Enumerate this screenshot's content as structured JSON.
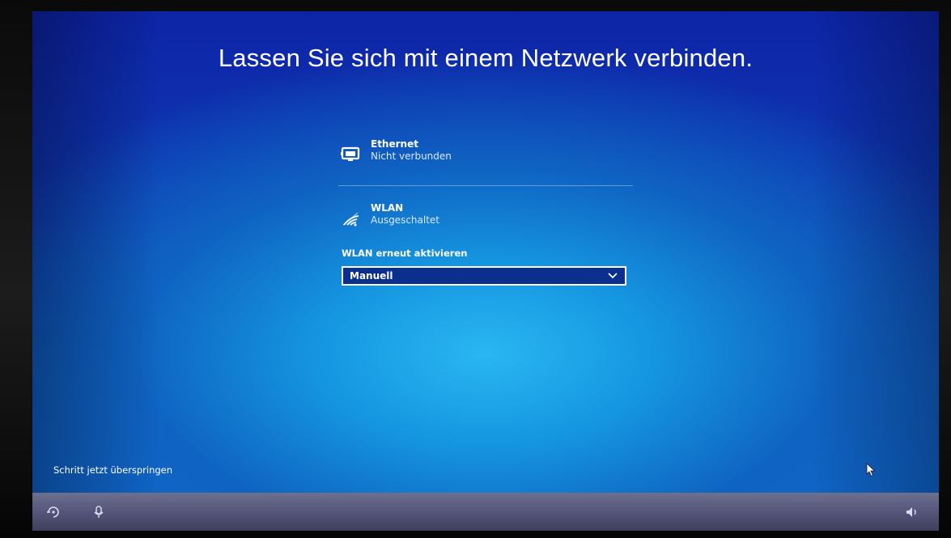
{
  "title": "Lassen Sie sich mit einem Netzwerk verbinden.",
  "networks": [
    {
      "name": "Ethernet",
      "status": "Nicht verbunden",
      "icon": "ethernet-icon"
    },
    {
      "name": "WLAN",
      "status": "Ausgeschaltet",
      "icon": "wifi-icon"
    }
  ],
  "wlan_reactivate": {
    "label": "WLAN erneut aktivieren",
    "selected": "Manuell"
  },
  "skip_link": "Schritt jetzt überspringen",
  "taskbar": {
    "left_icons": [
      "ease-of-access-icon",
      "microphone-icon"
    ],
    "right_icons": [
      "volume-icon"
    ]
  },
  "colors": {
    "background_top": "#0d24a6",
    "background_glow": "#29b6f2",
    "dropdown_bg": "#0a2f8c",
    "text": "#ffffff"
  }
}
